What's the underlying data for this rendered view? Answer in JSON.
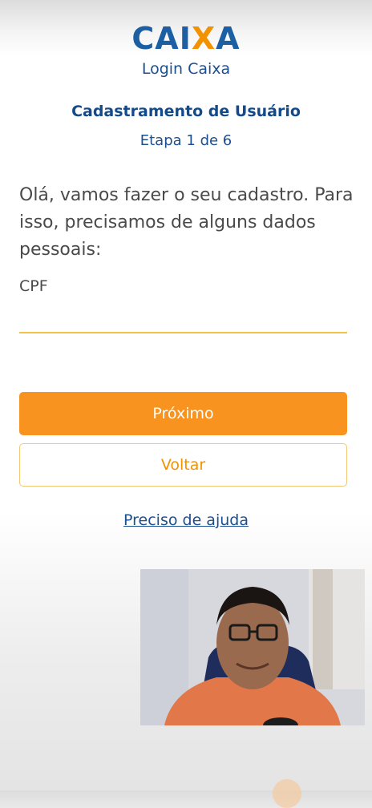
{
  "header": {
    "logo_text_before": "CAI",
    "logo_text_x": "X",
    "logo_text_after": "A",
    "login_title": "Login Caixa"
  },
  "page": {
    "title": "Cadastramento de Usuário",
    "step": "Etapa 1 de 6",
    "intro": "Olá, vamos fazer o seu cadastro. Para isso, precisamos de alguns dados pessoais:"
  },
  "form": {
    "cpf_label": "CPF",
    "cpf_value": "",
    "next_label": "Próximo",
    "back_label": "Voltar",
    "help_label": "Preciso de ajuda"
  },
  "colors": {
    "brand_blue": "#1c5fa3",
    "brand_orange": "#f39200",
    "button_orange": "#f7931e"
  },
  "icons": {
    "logo": "caixa-logo"
  }
}
